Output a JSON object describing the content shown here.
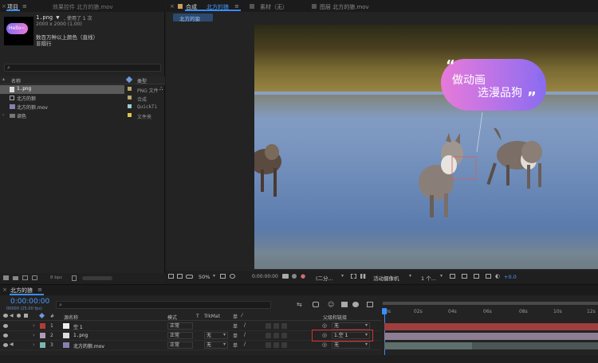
{
  "project_panel": {
    "tab_label": "项目",
    "menu_glyph": "≡",
    "effects_tab": "效果控件 北方的狼.mov",
    "thumb_text": "Hello~",
    "file_name": "1.png ▼",
    "usage": ", 使用了 1 次",
    "dimensions": "2000 x 2000 (1.00)",
    "desc_line1": "数百万种以上颜色（直线）",
    "desc_line2": "非隔行",
    "search_placeholder": "",
    "columns": {
      "name": "名称",
      "type": "类型"
    },
    "items": [
      {
        "name": "1.png",
        "type": "PNG 文件",
        "color": "#b8a86a",
        "selected": true,
        "icon": "image-file-icon"
      },
      {
        "name": "北方的狼",
        "type": "合成",
        "color": "#b8a86a",
        "selected": false,
        "icon": "composition-icon"
      },
      {
        "name": "北方的狼.mov",
        "type": "QuickTi",
        "color": "#9ccfc8",
        "selected": false,
        "icon": "video-file-icon"
      },
      {
        "name": "调色",
        "type": "文件夹",
        "color": "#e0c44a",
        "selected": false,
        "icon": "folder-icon"
      }
    ],
    "bpc": "8 bpc"
  },
  "comp_panel": {
    "tab_prefix": "合成",
    "tab_name": "北方的狼",
    "material_tab": "素材（无）",
    "layer_tab": "图层 北方的狼.mov",
    "breadcrumb": "北方的狼",
    "bubble_line1": "做动画",
    "bubble_line2": "选漫品狗",
    "zoom": "50%",
    "timecode": "0:00:00:00",
    "resolution": "(二分...",
    "camera": "活动摄像机",
    "views": "1 个...",
    "exposure": "+0.0"
  },
  "timeline": {
    "tab_name": "北方的狼",
    "timecode": "0:00:00:00",
    "frame_info": "00000 (25.00 fps)",
    "search_placeholder": "",
    "col_source": "源名称",
    "col_mode": "模式",
    "col_t": "T",
    "col_trkmat": "TrkMat",
    "col_parent": "父级和链接",
    "ticks": [
      "0s",
      "02s",
      "04s",
      "06s",
      "08s",
      "10s",
      "12s"
    ],
    "layers": [
      {
        "num": "1",
        "name": "空 1",
        "mode": "正常",
        "trkmat": "",
        "parent": "无",
        "label_color": "#b33a3a",
        "bar_color": "#9e3f3f"
      },
      {
        "num": "2",
        "name": "1.png",
        "mode": "正常",
        "trkmat": "无",
        "parent": "1.空 1",
        "label_color": "#b09ab8",
        "bar_color": "#8e7e94"
      },
      {
        "num": "3",
        "name": "北方的狼.mov",
        "mode": "正常",
        "trkmat": "无",
        "parent": "无",
        "label_color": "#7ab8b0",
        "bar_color": "#5e6f6c"
      }
    ]
  },
  "colors": {
    "accent_blue": "#3a8cff",
    "highlight_red": "#d83030",
    "bubble_pink": "#e67ad8",
    "bubble_purple": "#8a6cf0"
  }
}
